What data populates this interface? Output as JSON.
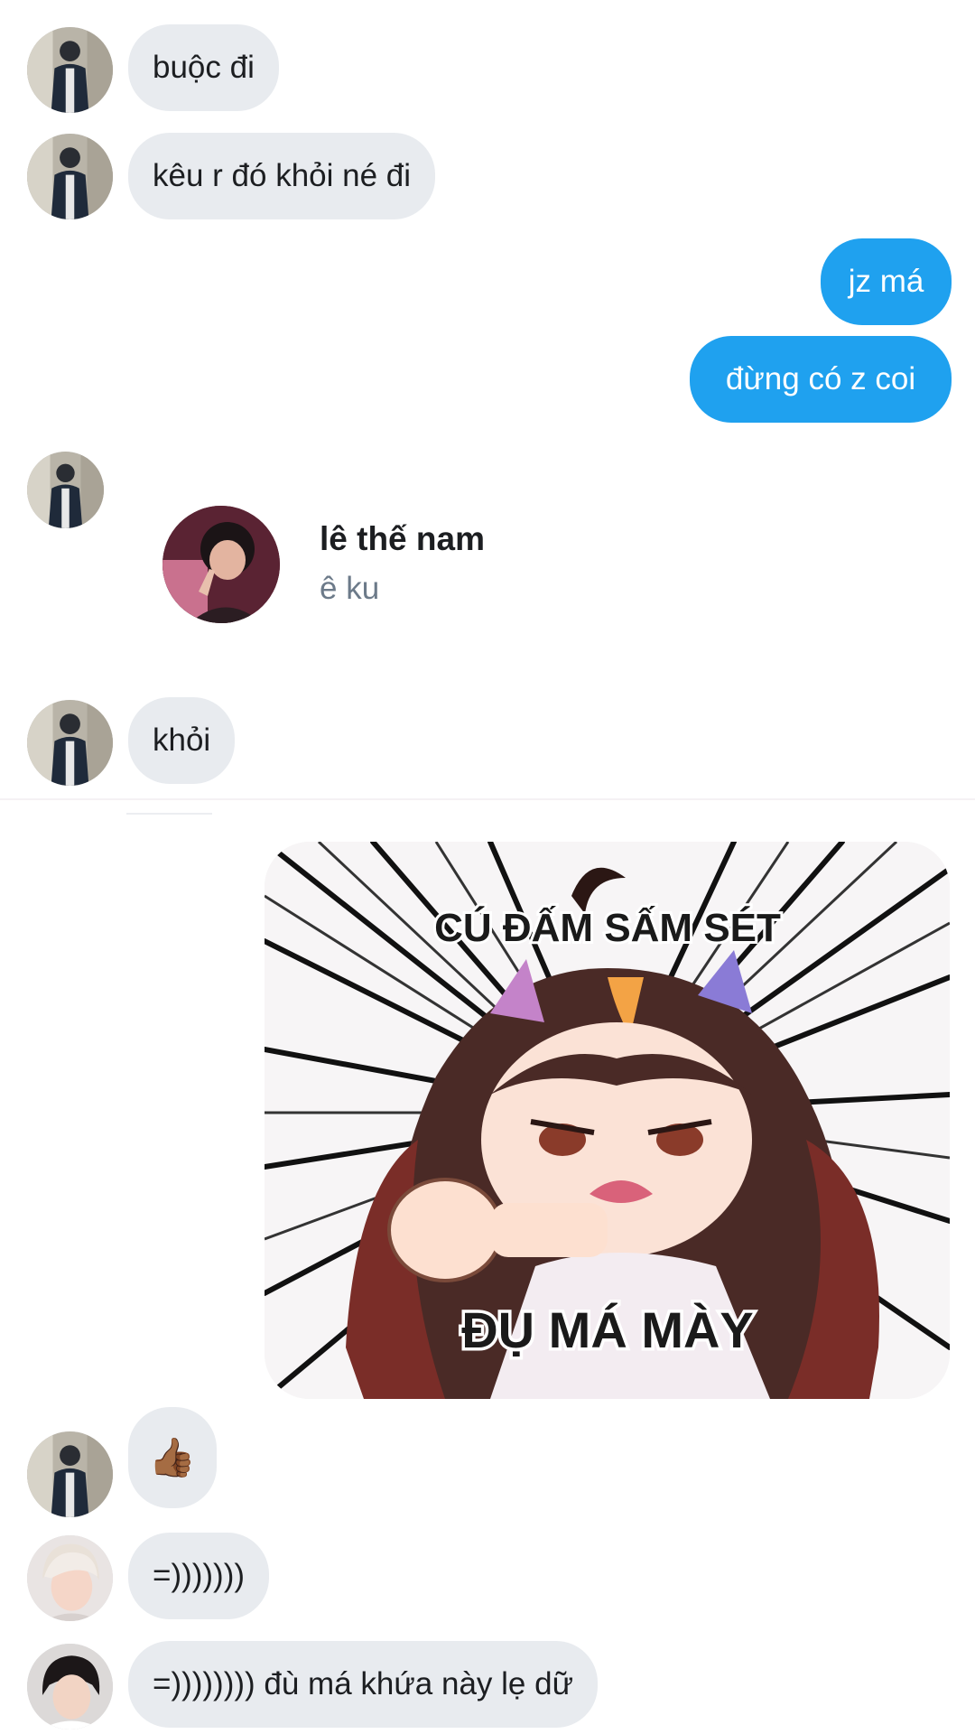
{
  "messages": [
    {
      "id": "m1",
      "direction": "incoming",
      "text": "buộc đi"
    },
    {
      "id": "m2",
      "direction": "incoming",
      "text": "kêu r đó khỏi né đi"
    },
    {
      "id": "m3",
      "direction": "outgoing",
      "text": "jz má"
    },
    {
      "id": "m4",
      "direction": "outgoing",
      "text": "đừng có z coi"
    },
    {
      "id": "m5",
      "direction": "incoming",
      "type": "contact_share"
    },
    {
      "id": "m6",
      "direction": "incoming",
      "text": "khỏi"
    },
    {
      "id": "m7",
      "direction": "outgoing",
      "type": "sticker"
    },
    {
      "id": "m8",
      "direction": "incoming",
      "text": "👍🏾"
    },
    {
      "id": "m9",
      "direction": "incoming",
      "text": "=)))))))"
    },
    {
      "id": "m10",
      "direction": "incoming",
      "text": "=)))))))) đù má khứa này lẹ dữ"
    }
  ],
  "contact_card": {
    "name": "lê thế nam",
    "subtitle": "ê ku"
  },
  "sticker": {
    "top_text": "CÚ ĐẤM SẤM SÉT",
    "bottom_text": "ĐỤ MÁ MÀY"
  },
  "colors": {
    "incoming_bubble": "#e8ebef",
    "outgoing_bubble": "#1fa1ef",
    "text_primary": "#1c1e21",
    "text_secondary": "#6c7a89"
  },
  "icons": {
    "avatar_a": "user-avatar-dark-jacket",
    "avatar_b": "user-avatar-blond",
    "avatar_c": "user-avatar-dark-hair",
    "contact": "contact-avatar"
  }
}
